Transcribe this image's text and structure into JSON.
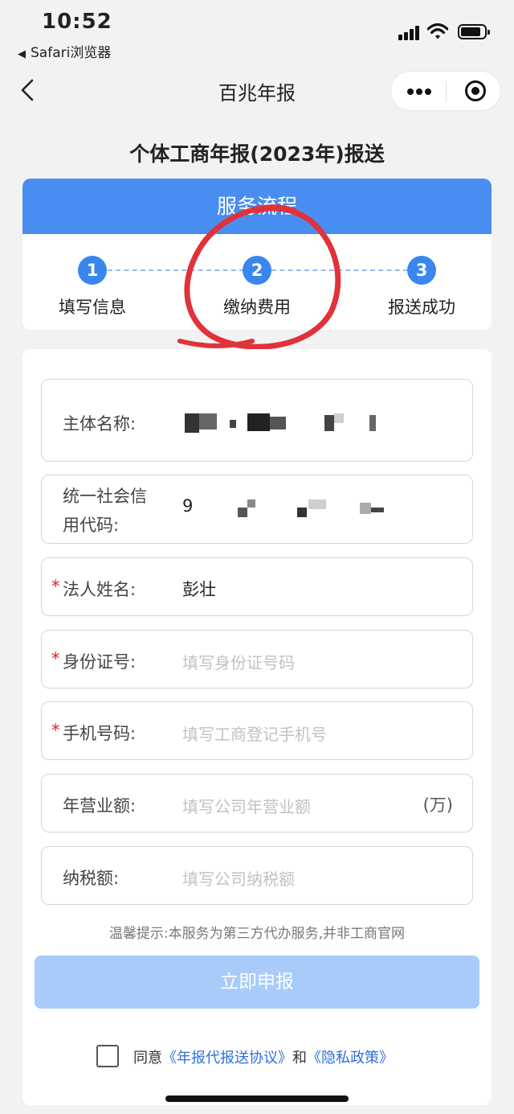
{
  "status": {
    "time": "10:52",
    "back_app": "Safari浏览器"
  },
  "nav": {
    "title": "百兆年报"
  },
  "page": {
    "title": "个体工商年报(2023年)报送"
  },
  "flow": {
    "header": "服务流程",
    "steps": [
      {
        "num": "1",
        "label": "填写信息"
      },
      {
        "num": "2",
        "label": "缴纳费用"
      },
      {
        "num": "3",
        "label": "报送成功"
      }
    ]
  },
  "form": {
    "fields": [
      {
        "label": "主体名称:",
        "value": ""
      },
      {
        "label_line1": "统一社会信",
        "label_line2": "用代码:",
        "value_prefix": "9"
      },
      {
        "label": "法人姓名:",
        "value": "彭壮",
        "required": "*"
      },
      {
        "label": "身份证号:",
        "placeholder": "填写身份证号码",
        "required": "*"
      },
      {
        "label": "手机号码:",
        "placeholder": "填写工商登记手机号",
        "required": "*"
      },
      {
        "label": "年营业额:",
        "placeholder": "填写公司年营业额",
        "unit": "(万)"
      },
      {
        "label": "纳税额:",
        "placeholder": "填写公司纳税额"
      }
    ],
    "tip": "温馨提示:本服务为第三方代办服务,并非工商官网",
    "submit_label": "立即申报",
    "agree": {
      "prefix": "同意",
      "link1": "《年报代报送协议》",
      "middle": "和",
      "link2": "《隐私政策》"
    }
  }
}
